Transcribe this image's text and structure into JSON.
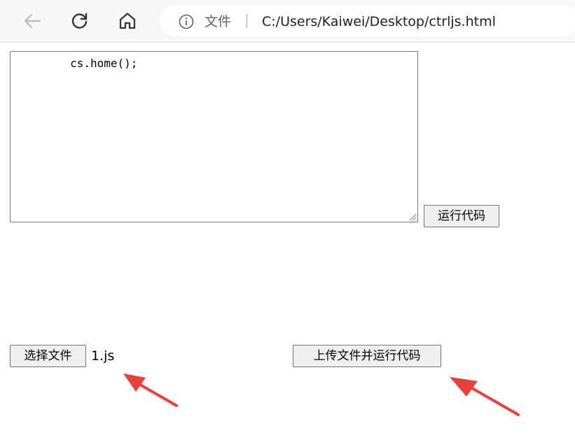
{
  "browser": {
    "scheme_label": "文件",
    "url": "C:/Users/Kaiwei/Desktop/ctrljs.html"
  },
  "editor": {
    "code": "        cs.home();"
  },
  "buttons": {
    "run_label": "运行代码",
    "choose_file_label": "选择文件",
    "upload_run_label": "上传文件并运行代码"
  },
  "file_input": {
    "selected_file": "1.js"
  },
  "colors": {
    "annotation_arrow": "#e8403a",
    "toolbar_bg": "#f7f7f7",
    "button_bg": "#efefef"
  }
}
